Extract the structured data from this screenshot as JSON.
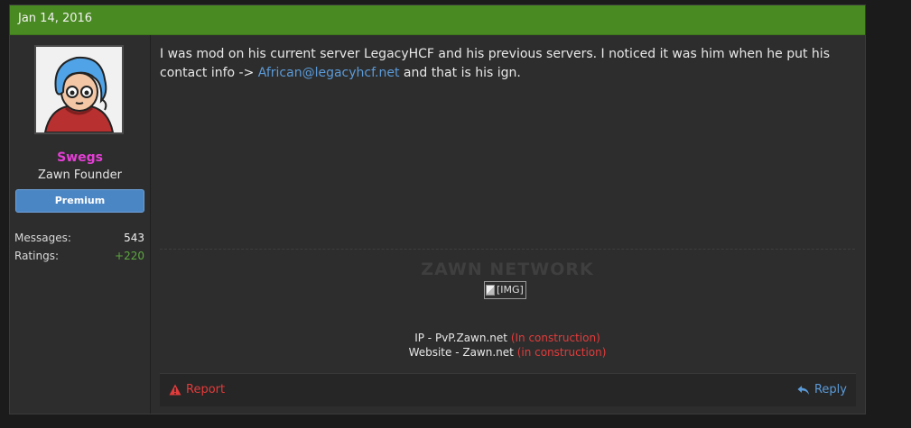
{
  "post": {
    "date": "Jan 14, 2016",
    "message": {
      "text_before_link": "I was mod on his current server LegacyHCF and his previous servers. I noticed it was him when he put his contact info -> ",
      "link_text": "African@legacyhcf.net",
      "text_after_link": " and that is his ign."
    }
  },
  "user": {
    "name": "Swegs",
    "title": "Zawn Founder",
    "badge": "Premium",
    "name_color": "#e53fd6",
    "stats": [
      {
        "label": "Messages:",
        "value": "543"
      },
      {
        "label": "Ratings:",
        "value": "+220"
      }
    ]
  },
  "signature": {
    "title": "ZAWN NETWORK",
    "image_alt": "[IMG]",
    "lines": [
      {
        "text": "IP - PvP.Zawn.net",
        "note": "(In construction)"
      },
      {
        "text": "Website - Zawn.net",
        "note": "(in construction)"
      }
    ]
  },
  "actions": {
    "report_label": "Report",
    "reply_label": "Reply"
  },
  "colors": {
    "header_green": "#4a8a22",
    "link_blue": "#5b9ad8",
    "alert_red": "#e23b3b",
    "positive_green": "#5ca83e"
  },
  "icons": {
    "report": "warning-triangle-icon",
    "reply": "reply-arrow-icon",
    "image": "broken-image-icon"
  }
}
